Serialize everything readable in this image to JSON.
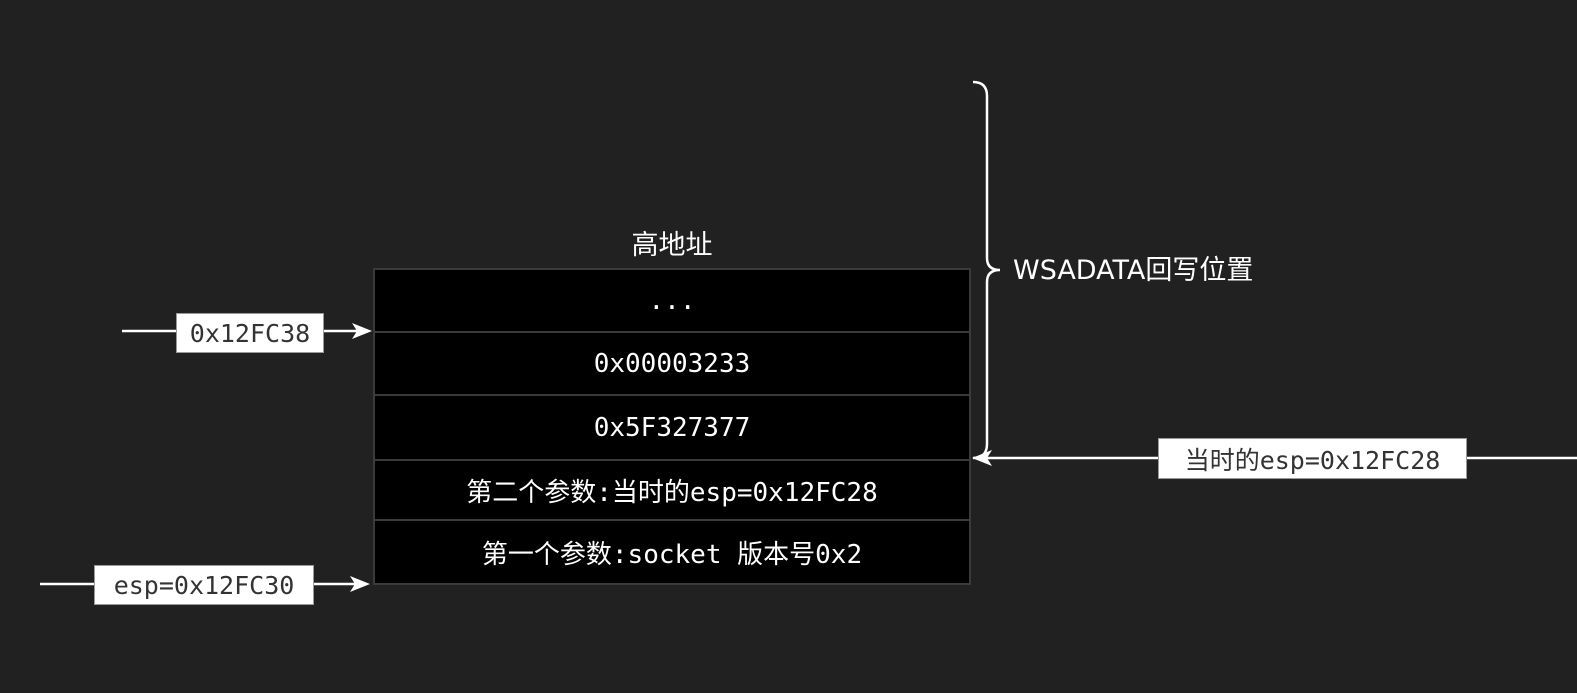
{
  "stack": {
    "title": "高地址",
    "cells": [
      "...",
      "0x00003233",
      "0x5F327377",
      "第二个参数:当时的esp=0x12FC28",
      "第一个参数:socket 版本号0x2"
    ]
  },
  "pointers": {
    "top_left": "0x12FC38",
    "bottom_left": "esp=0x12FC30",
    "right": "当时的esp=0x12FC28"
  },
  "brace": {
    "label": "WSADATA回写位置"
  },
  "colors": {
    "background": "#212121",
    "cell_fill": "#000000",
    "cell_border": "#3a3a3a",
    "line": "#ffffff",
    "tag_fill": "#ffffff",
    "tag_text": "#333333"
  }
}
